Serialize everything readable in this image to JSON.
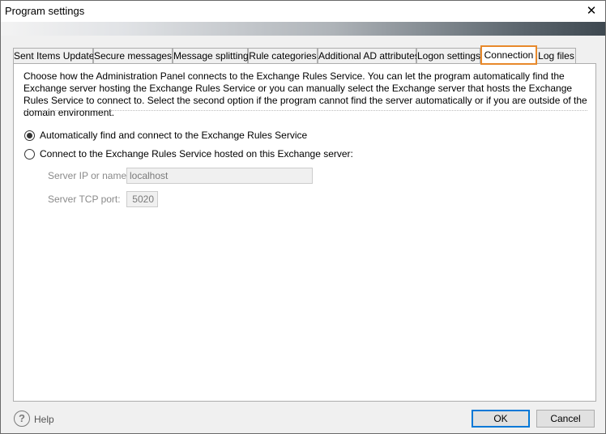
{
  "window": {
    "title": "Program settings",
    "close_label": "✕"
  },
  "tabs": [
    {
      "label": "Sent Items Update"
    },
    {
      "label": "Secure messages"
    },
    {
      "label": "Message splitting"
    },
    {
      "label": "Rule categories"
    },
    {
      "label": "Additional AD attributes"
    },
    {
      "label": "Logon settings"
    },
    {
      "label": "Connection"
    },
    {
      "label": "Log files"
    }
  ],
  "active_tab": "Connection",
  "connection": {
    "description": "Choose how the Administration Panel connects to the Exchange Rules Service. You can let the program automatically find the Exchange server hosting the Exchange Rules Service or you can manually select the Exchange server that hosts the Exchange Rules Service to connect to. Select the second option if the program cannot find the server automatically or if you are outside of the domain environment.",
    "option_auto": {
      "label": "Automatically find and connect to the Exchange Rules Service",
      "checked": true
    },
    "option_manual": {
      "label": "Connect to the Exchange Rules Service hosted on this Exchange server:",
      "checked": false
    },
    "server_label": "Server IP or name:",
    "server_value": "localhost",
    "port_label": "Server TCP port:",
    "port_value": "5020"
  },
  "footer": {
    "help_icon": "question-circle-icon",
    "help_label": "Help",
    "ok_label": "OK",
    "cancel_label": "Cancel"
  },
  "colors": {
    "active_tab_highlight": "#e8892b",
    "default_button_border": "#0078d7"
  }
}
